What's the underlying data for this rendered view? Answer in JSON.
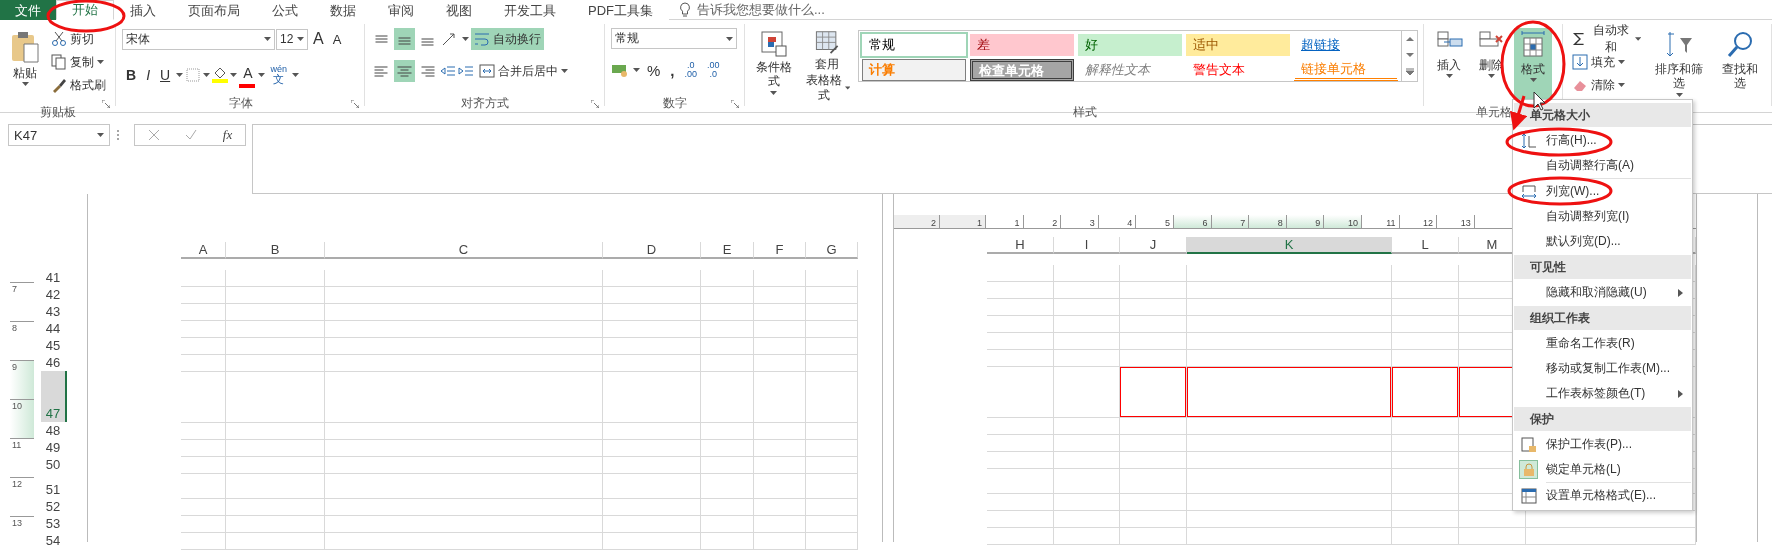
{
  "tabs": [
    {
      "label": "文件",
      "kind": "file",
      "selected": false
    },
    {
      "label": "开始",
      "kind": "tab",
      "selected": true
    },
    {
      "label": "插入",
      "kind": "tab",
      "selected": false
    },
    {
      "label": "页面布局",
      "kind": "tab",
      "selected": false
    },
    {
      "label": "公式",
      "kind": "tab",
      "selected": false
    },
    {
      "label": "数据",
      "kind": "tab",
      "selected": false
    },
    {
      "label": "审阅",
      "kind": "tab",
      "selected": false
    },
    {
      "label": "视图",
      "kind": "tab",
      "selected": false
    },
    {
      "label": "开发工具",
      "kind": "tab",
      "selected": false
    },
    {
      "label": "PDF工具集",
      "kind": "tab",
      "selected": false
    }
  ],
  "tell_me": {
    "placeholder": "告诉我您想要做什么..."
  },
  "ribbon": {
    "clipboard": {
      "paste": "粘贴",
      "cut": "剪切",
      "copy": "复制",
      "format_painter": "格式刷",
      "label": "剪贴板"
    },
    "font": {
      "name": "宋体",
      "size": "12",
      "grow": "A",
      "shrink": "A",
      "bold": "B",
      "italic": "I",
      "underline": "U",
      "font_color": "A",
      "phonetic_top": "wén",
      "phonetic_bottom": "文",
      "label": "字体"
    },
    "alignment": {
      "buttons": [
        {
          "kind": "top",
          "selected": false
        },
        {
          "kind": "middle",
          "selected": true
        },
        {
          "kind": "bottom",
          "selected": false
        },
        {
          "kind": "left",
          "selected": false
        },
        {
          "kind": "center",
          "selected": true
        },
        {
          "kind": "right",
          "selected": false
        }
      ],
      "wrap": {
        "label": "自动换行",
        "on": true
      },
      "merge": "合并后居中",
      "label": "对齐方式"
    },
    "number": {
      "format": "常规",
      "percent": "%",
      "comma": ",",
      "increase_decimal": [
        ".0",
        ".00"
      ],
      "decrease_decimal": [
        ".00",
        ".0"
      ],
      "label": "数字"
    },
    "styles": {
      "conditional": "条件格式",
      "table_top": "套用",
      "table_bottom": "表格格式",
      "label": "样式",
      "gallery": [
        {
          "label": "常规",
          "kind": "normal",
          "selected": true
        },
        {
          "label": "差",
          "kind": "bad",
          "selected": false
        },
        {
          "label": "好",
          "kind": "good",
          "selected": false
        },
        {
          "label": "适中",
          "kind": "neutral",
          "selected": false
        },
        {
          "label": "超链接",
          "kind": "hyperlink",
          "selected": false
        },
        {
          "label": "计算",
          "kind": "calculation",
          "selected": false
        },
        {
          "label": "检查单元格",
          "kind": "check",
          "selected": false
        },
        {
          "label": "解释性文本",
          "kind": "explanatory",
          "selected": false
        },
        {
          "label": "警告文本",
          "kind": "warning",
          "selected": false
        },
        {
          "label": "链接单元格",
          "kind": "linked",
          "selected": false
        }
      ]
    },
    "cells": {
      "label": "单元格",
      "buttons": [
        {
          "label": "插入",
          "kind": "insert",
          "selected": false
        },
        {
          "label": "删除",
          "kind": "delete",
          "selected": false
        },
        {
          "label": "格式",
          "kind": "format",
          "selected": true
        }
      ]
    },
    "editing": {
      "autosum": "自动求和",
      "fill": "填充",
      "clear": "清除",
      "sort": "排序和筛选",
      "find": "查找和选"
    }
  },
  "formula_bar": {
    "name_box": "K47",
    "fx": "fx"
  },
  "ruler": {
    "margin": [
      {
        "label": "2"
      },
      {
        "label": "1"
      }
    ],
    "ticks": [
      {
        "label": "1",
        "highlighted": false
      },
      {
        "label": "2",
        "highlighted": false
      },
      {
        "label": "3",
        "highlighted": false
      },
      {
        "label": "4",
        "highlighted": false
      },
      {
        "label": "5",
        "highlighted": false
      },
      {
        "label": "6",
        "highlighted": true
      },
      {
        "label": "7",
        "highlighted": true
      },
      {
        "label": "8",
        "highlighted": true
      },
      {
        "label": "9",
        "highlighted": true
      },
      {
        "label": "10",
        "highlighted": true
      },
      {
        "label": "11",
        "highlighted": false
      },
      {
        "label": "12",
        "highlighted": false
      },
      {
        "label": "13",
        "highlighted": false
      }
    ]
  },
  "vertical_ruler": [
    {
      "label": "7",
      "highlighted": false
    },
    {
      "label": "8",
      "highlighted": false
    },
    {
      "label": "9",
      "highlighted": true
    },
    {
      "label": "10",
      "highlighted": true
    },
    {
      "label": "11",
      "highlighted": false
    },
    {
      "label": "12",
      "highlighted": false
    },
    {
      "label": "13",
      "highlighted": false
    }
  ],
  "left_page": {
    "columns": [
      {
        "label": "A",
        "selected": false
      },
      {
        "label": "B",
        "selected": false
      },
      {
        "label": "C",
        "selected": false
      },
      {
        "label": "D",
        "selected": false
      },
      {
        "label": "E",
        "selected": false
      },
      {
        "label": "F",
        "selected": false
      },
      {
        "label": "G",
        "selected": false
      }
    ]
  },
  "right_page": {
    "columns": [
      {
        "label": "H",
        "selected": false,
        "outlined": false
      },
      {
        "label": "I",
        "selected": false,
        "outlined": false
      },
      {
        "label": "J",
        "selected": false,
        "outlined": true
      },
      {
        "label": "K",
        "selected": true,
        "outlined": true
      },
      {
        "label": "L",
        "selected": false,
        "outlined": true
      },
      {
        "label": "M",
        "selected": false,
        "outlined": true
      }
    ]
  },
  "rows": [
    {
      "label": "41",
      "selected": false,
      "outlined": false
    },
    {
      "label": "42",
      "selected": false,
      "outlined": false
    },
    {
      "label": "43",
      "selected": false,
      "outlined": false
    },
    {
      "label": "44",
      "selected": false,
      "outlined": false
    },
    {
      "label": "45",
      "selected": false,
      "outlined": false
    },
    {
      "label": "46",
      "selected": false,
      "outlined": false
    },
    {
      "label": "47",
      "selected": true,
      "outlined": true
    },
    {
      "label": "48",
      "selected": false,
      "outlined": false
    },
    {
      "label": "49",
      "selected": false,
      "outlined": false
    },
    {
      "label": "50",
      "selected": false,
      "outlined": false
    },
    {
      "label": "51",
      "selected": false,
      "outlined": false
    },
    {
      "label": "52",
      "selected": false,
      "outlined": false
    },
    {
      "label": "53",
      "selected": false,
      "outlined": false
    },
    {
      "label": "54",
      "selected": false,
      "outlined": false
    }
  ],
  "menu": {
    "sections": [
      {
        "title": "单元格大小",
        "groups": [
          [
            {
              "label": "行高(H)...",
              "kind": "row_height",
              "submenu": false,
              "checked": false
            },
            {
              "label": "自动调整行高(A)",
              "kind": "plain",
              "submenu": false,
              "checked": false
            }
          ],
          [
            {
              "label": "列宽(W)...",
              "kind": "column_width",
              "submenu": false,
              "checked": false
            },
            {
              "label": "自动调整列宽(I)",
              "kind": "plain",
              "submenu": false,
              "checked": false
            },
            {
              "label": "默认列宽(D)...",
              "kind": "plain",
              "submenu": false,
              "checked": false
            }
          ]
        ]
      },
      {
        "title": "可见性",
        "groups": [
          [
            {
              "label": "隐藏和取消隐藏(U)",
              "kind": "plain",
              "submenu": true,
              "checked": false
            }
          ]
        ]
      },
      {
        "title": "组织工作表",
        "groups": [
          [
            {
              "label": "重命名工作表(R)",
              "kind": "plain",
              "submenu": false,
              "checked": false
            },
            {
              "label": "移动或复制工作表(M)...",
              "kind": "plain",
              "submenu": false,
              "checked": false
            },
            {
              "label": "工作表标签颜色(T)",
              "kind": "plain",
              "submenu": true,
              "checked": false
            }
          ]
        ]
      },
      {
        "title": "保护",
        "groups": [
          [
            {
              "label": "保护工作表(P)...",
              "kind": "protect",
              "submenu": false,
              "checked": false
            },
            {
              "label": "锁定单元格(L)",
              "kind": "lock",
              "submenu": false,
              "checked": true
            }
          ],
          [
            {
              "label": "设置单元格格式(E)...",
              "kind": "format_cells",
              "submenu": false,
              "checked": false
            }
          ]
        ]
      }
    ]
  }
}
